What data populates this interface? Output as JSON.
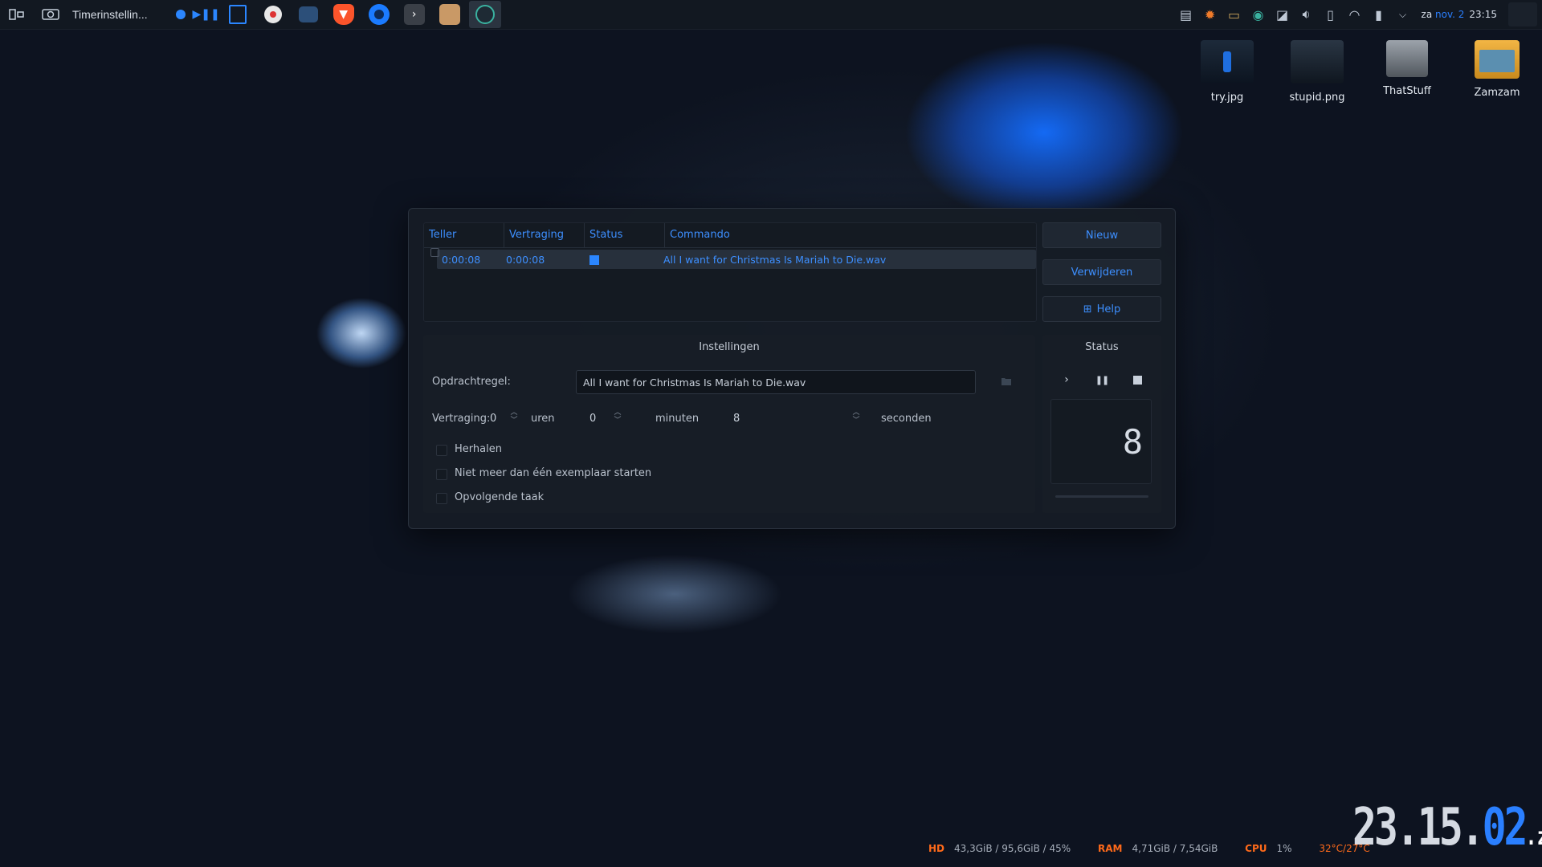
{
  "taskbar": {
    "task_title": "Timerinstellin...",
    "clock_day": "za",
    "clock_date": "nov. 2",
    "clock_time": "23:15"
  },
  "desktop_icons": [
    {
      "label": "try.jpg"
    },
    {
      "label": "stupid.png"
    },
    {
      "label": "ThatStuff"
    },
    {
      "label": "Zamzam"
    }
  ],
  "table": {
    "headers": [
      "Teller",
      "Vertraging",
      "Status",
      "Commando"
    ],
    "rows": [
      {
        "teller": "0:00:08",
        "vertraging": "0:00:08",
        "commando": "All I want for Christmas Is Mariah to Die.wav"
      }
    ]
  },
  "buttons": {
    "nieuw": "Nieuw",
    "verwijderen": "Verwijderen",
    "help": "Help"
  },
  "settings": {
    "title": "Instellingen",
    "command_label": "Opdrachtregel:",
    "command_value": "All I want for Christmas Is Mariah to Die.wav",
    "delay_label": "Vertraging:",
    "hours_value": "0",
    "hours_label": "uren",
    "minutes_value": "0",
    "minutes_label": "minuten",
    "seconds_value": "8",
    "seconds_label": "seconden",
    "repeat_label": "Herhalen",
    "single_instance_label": "Niet meer dan één exemplaar starten",
    "next_task_label": "Opvolgende taak"
  },
  "status": {
    "title": "Status",
    "display": "8",
    "progress": 0.0
  },
  "sysinfo": {
    "hd_label": "HD",
    "hd_value": "43,3GiB / 95,6GiB / 45%",
    "ram_label": "RAM",
    "ram_value": "4,71GiB / 7,54GiB",
    "cpu_label": "CPU",
    "cpu_value": "1%",
    "temp_value": "32°C/27°C"
  },
  "big_clock": {
    "hm": "23.15.",
    "sec": "02",
    "day": ".za"
  },
  "colors": {
    "accent": "#3d8fff",
    "status_active": "#2b86ff",
    "sysinfo_label": "#ff6a1a"
  }
}
